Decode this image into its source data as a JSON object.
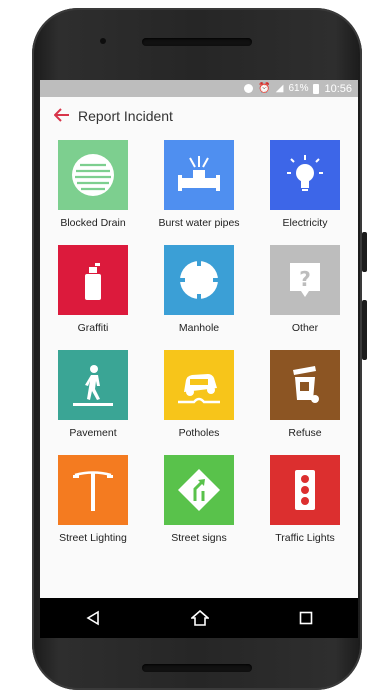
{
  "status_bar": {
    "battery_text": "61%",
    "time": "10:56"
  },
  "app_bar": {
    "title": "Report Incident"
  },
  "colors": {
    "accent": "#d8354a"
  },
  "incidents": [
    {
      "label": "Blocked Drain",
      "color": "#7dcf8f",
      "icon": "drain-icon"
    },
    {
      "label": "Burst water pipes",
      "color": "#4f8ff0",
      "icon": "burst-pipe-icon"
    },
    {
      "label": "Electricity",
      "color": "#3d66e8",
      "icon": "lightbulb-icon"
    },
    {
      "label": "Graffiti",
      "color": "#dc1a3c",
      "icon": "spray-can-icon"
    },
    {
      "label": "Manhole",
      "color": "#3b9fd6",
      "icon": "manhole-icon"
    },
    {
      "label": "Other",
      "color": "#bdbdbd",
      "icon": "question-icon"
    },
    {
      "label": "Pavement",
      "color": "#3aa595",
      "icon": "pedestrian-icon"
    },
    {
      "label": "Potholes",
      "color": "#f7c51a",
      "icon": "pothole-car-icon"
    },
    {
      "label": "Refuse",
      "color": "#8c5523",
      "icon": "bin-icon"
    },
    {
      "label": "Street Lighting",
      "color": "#f47b20",
      "icon": "street-lamp-icon"
    },
    {
      "label": "Street signs",
      "color": "#59c24b",
      "icon": "road-sign-icon"
    },
    {
      "label": "Traffic Lights",
      "color": "#dc2f2f",
      "icon": "traffic-light-icon"
    }
  ],
  "nav": {
    "back_icon": "back-triangle-icon",
    "home_icon": "home-circle-icon",
    "recents_icon": "recents-square-icon"
  }
}
